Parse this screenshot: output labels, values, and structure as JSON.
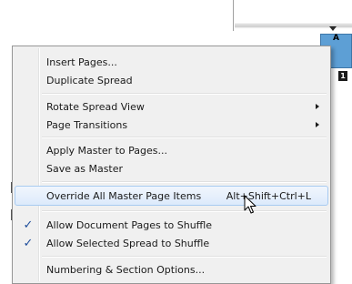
{
  "background": {
    "page_prefix": "A",
    "page_number": "1",
    "panel_color": "#5d9fd5"
  },
  "menu": {
    "highlight_color": "#dceafb",
    "items": [
      {
        "label": "Insert Pages..."
      },
      {
        "label": "Duplicate Spread"
      },
      {
        "label": "Rotate Spread View",
        "submenu": true
      },
      {
        "label": "Page Transitions",
        "submenu": true
      },
      {
        "label": "Apply Master to Pages..."
      },
      {
        "label": "Save as Master"
      },
      {
        "label": "Override All Master Page Items",
        "shortcut": "Alt+Shift+Ctrl+L",
        "highlighted": true
      },
      {
        "label": "Allow Document Pages to Shuffle",
        "checked": true
      },
      {
        "label": "Allow Selected Spread to Shuffle",
        "checked": true
      },
      {
        "label": "Numbering & Section Options..."
      }
    ]
  },
  "icons": {
    "check": "checkmark-icon",
    "submenu": "submenu-arrow-icon",
    "cursor": "arrow-cursor-icon"
  }
}
